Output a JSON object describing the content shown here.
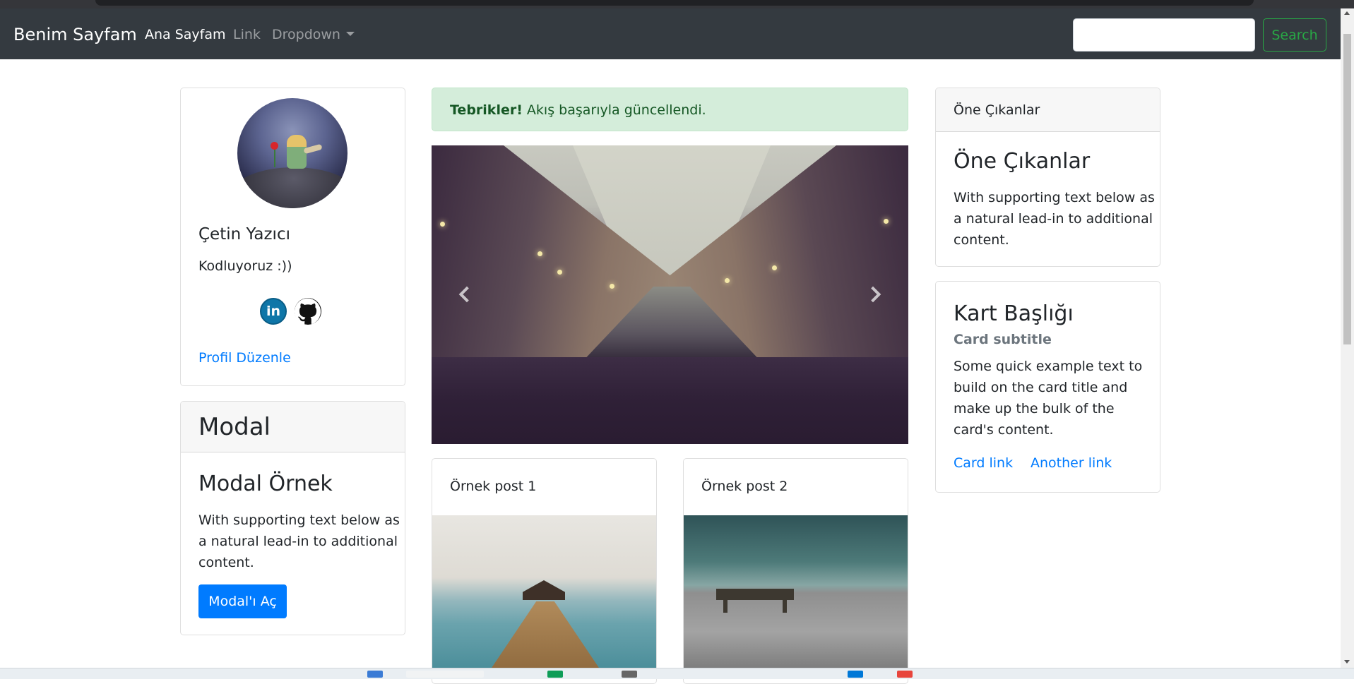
{
  "navbar": {
    "brand": "Benim Sayfam",
    "links": [
      "Ana Sayfam",
      "Link",
      "Dropdown"
    ],
    "search_label": "Search",
    "search_value": ""
  },
  "profile": {
    "name": "Çetin Yazıcı",
    "bio": "Kodluyoruz :))",
    "social_icons": [
      "linkedin-icon",
      "github-icon"
    ],
    "linkedin_glyph": "in",
    "edit_link": "Profil Düzenle"
  },
  "modal_card": {
    "header": "Modal",
    "title": "Modal Örnek",
    "text": "With supporting text below as a natural lead-in to additional content.",
    "button": "Modal'ı Aç"
  },
  "alert": {
    "strong": "Tebrikler!",
    "message": " Akış başarıyla güncellendi."
  },
  "posts": [
    {
      "title": "Örnek post 1"
    },
    {
      "title": "Örnek post 2"
    }
  ],
  "featured": {
    "header": "Öne Çıkanlar",
    "title": "Öne Çıkanlar",
    "text": "With supporting text below as a natural lead-in to additional content."
  },
  "kart": {
    "title": "Kart Başlığı",
    "subtitle": "Card subtitle",
    "text": "Some quick example text to build on the card title and make up the bulk of the card's content.",
    "link1": "Card link",
    "link2": "Another link"
  },
  "colors": {
    "navbar_bg": "#343a40",
    "link": "#007bff",
    "success": "#28a745",
    "alert_bg": "#d4edda",
    "alert_text": "#155724",
    "linkedin": "#0e76a8"
  }
}
